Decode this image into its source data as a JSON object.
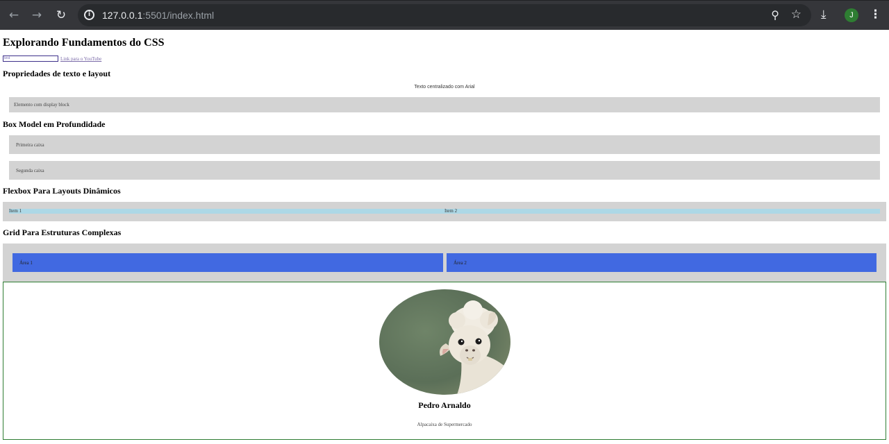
{
  "browser": {
    "back_icon": "arrow-left-icon",
    "forward_icon": "arrow-right-icon",
    "reload_icon": "reload-icon",
    "url_host": "127.0.0.1",
    "url_rest": ":5501/index.html",
    "avatar_initial": "J"
  },
  "page": {
    "title": "Explorando Fundamentos do CSS",
    "link_input_value": "test",
    "youtube_link": "Link para o YouTube"
  },
  "sections": {
    "text_layout": {
      "title": "Propriedades de texto e layout",
      "centered_text": "Texto centralizado com Arial",
      "block_element": "Elemento com display block"
    },
    "box_model": {
      "title": "Box Model em Profundidade",
      "first_box": "Primeira caixa",
      "second_box": "Segunda caixa"
    },
    "flexbox": {
      "title": "Flexbox Para Layouts Dinâmicos",
      "items": [
        "Item 1",
        "Item 2"
      ]
    },
    "grid": {
      "title": "Grid Para Estruturas Complexas",
      "areas": [
        "Área 1",
        "Área 2"
      ]
    }
  },
  "profile": {
    "name": "Pedro Arnaldo",
    "role": "Alpacaixa de Supermercado"
  },
  "colors": {
    "gray_box": "#d3d3d3",
    "flex_item": "#add8e6",
    "grid_cell": "#4169e1",
    "card_border": "#2e7d32"
  }
}
